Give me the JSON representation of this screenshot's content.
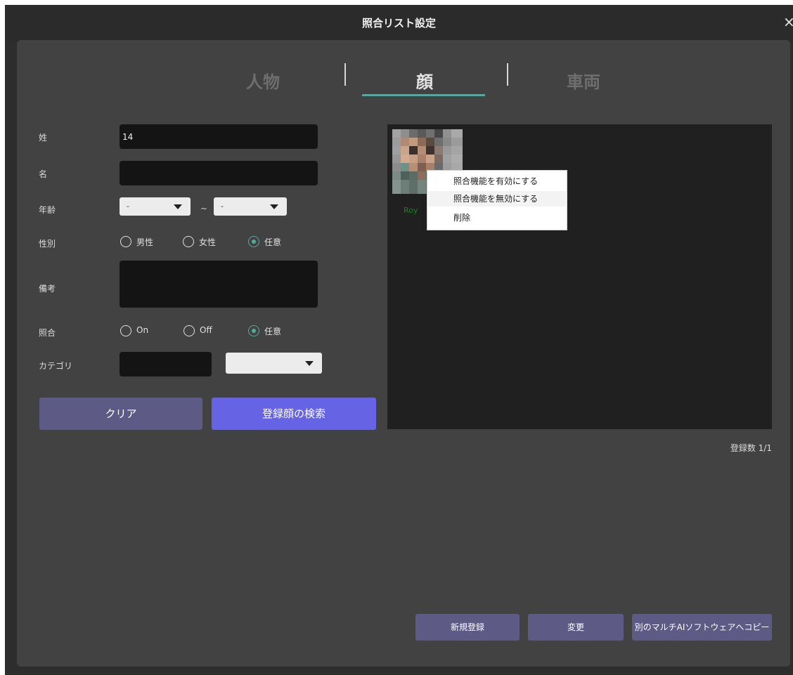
{
  "window": {
    "title": "照合リスト設定",
    "close_label": "×"
  },
  "tabs": [
    {
      "label": "人物",
      "active": false
    },
    {
      "label": "顔",
      "active": true
    },
    {
      "label": "車両",
      "active": false
    }
  ],
  "form": {
    "last_name": {
      "label": "姓",
      "value": "14"
    },
    "first_name": {
      "label": "名",
      "value": ""
    },
    "age": {
      "label": "年齢",
      "from": "-",
      "separator": "~",
      "to": "-"
    },
    "gender": {
      "label": "性別",
      "options": [
        "男性",
        "女性",
        "任意"
      ],
      "selected": "任意"
    },
    "remarks": {
      "label": "備考",
      "value": ""
    },
    "matching": {
      "label": "照合",
      "options": [
        "On",
        "Off",
        "任意"
      ],
      "selected": "任意"
    },
    "category": {
      "label": "カテゴリ",
      "value": "",
      "select_value": ""
    }
  },
  "buttons": {
    "clear": "クリア",
    "search": "登録顔の検索",
    "new_register": "新規登録",
    "change": "変更",
    "copy": "別のマルチAIソフトウェアへコピー"
  },
  "gallery": {
    "item_name": "Roy",
    "context_menu": [
      "照合機能を有効にする",
      "照合機能を無効にする",
      "削除"
    ],
    "count_label": "登録数 1/1"
  },
  "colors": {
    "accent": "#55a89e",
    "primary_button": "#6664e4",
    "secondary_button": "#5d5a85",
    "panel": "#424242"
  }
}
